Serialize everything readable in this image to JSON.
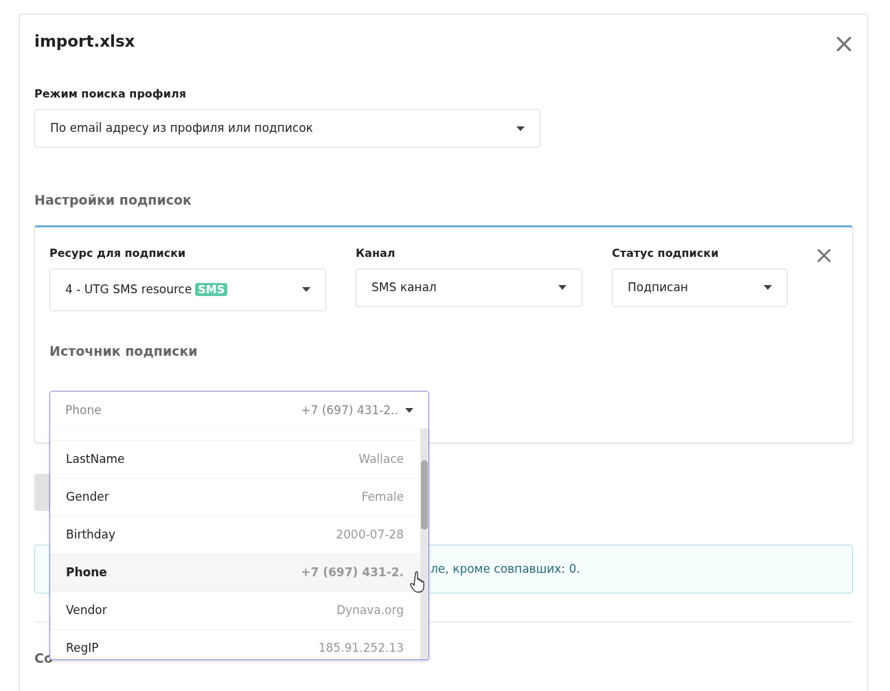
{
  "dialog": {
    "title": "import.xlsx"
  },
  "search_mode": {
    "label": "Режим поиска профиля",
    "value": "По email адресу из профиля или подписок"
  },
  "subscription_settings": {
    "heading": "Настройки подписок",
    "fields": [
      {
        "label": "Ресурс для подписки",
        "value": "4 - UTG SMS resource",
        "tag": "SMS"
      },
      {
        "label": "Канал",
        "value": "SMS канал"
      },
      {
        "label": "Статус подписки",
        "value": "Подписан"
      }
    ],
    "source": {
      "heading": "Источник подписки",
      "field": "Phone",
      "sample": "+7 (697) 431-2..",
      "options": [
        {
          "name": "LastName",
          "sample": "Wallace",
          "selected": false
        },
        {
          "name": "Gender",
          "sample": "Female",
          "selected": false
        },
        {
          "name": "Birthday",
          "sample": "2000-07-28",
          "selected": false
        },
        {
          "name": "Phone",
          "sample": "+7 (697) 431-2.",
          "selected": true
        },
        {
          "name": "Vendor",
          "sample": "Dynava.org",
          "selected": false
        },
        {
          "name": "RegIP",
          "sample": "185.91.252.13",
          "selected": false
        }
      ]
    }
  },
  "info": {
    "text": "ле, кроме совпавших: 0."
  },
  "columns_heading": "Со"
}
